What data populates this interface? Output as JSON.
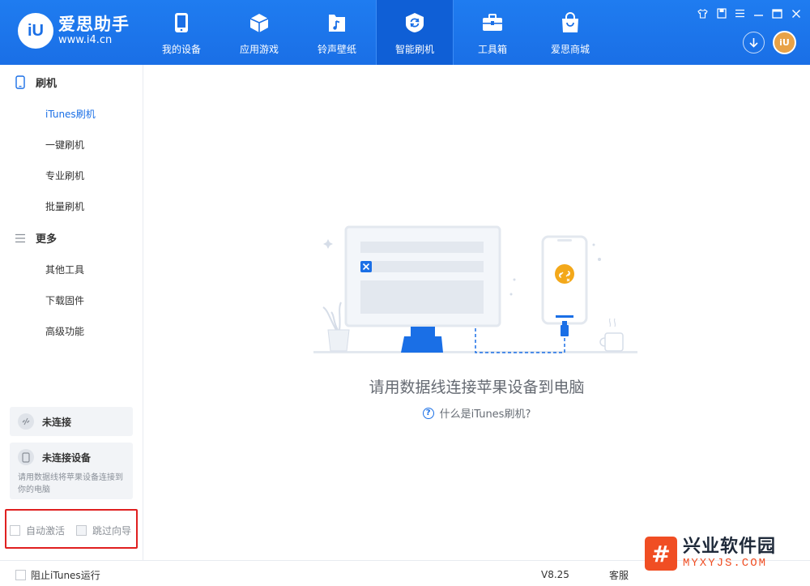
{
  "app": {
    "name": "爱思助手",
    "url": "www.i4.cn",
    "logo_mark": "iU",
    "brand_color": "#1a6fe6"
  },
  "nav": {
    "items": [
      {
        "label": "我的设备",
        "icon": "phone-icon"
      },
      {
        "label": "应用游戏",
        "icon": "cube-icon"
      },
      {
        "label": "铃声壁纸",
        "icon": "music-file-icon"
      },
      {
        "label": "智能刷机",
        "icon": "refresh-shield-icon",
        "active": true
      },
      {
        "label": "工具箱",
        "icon": "toolbox-icon"
      },
      {
        "label": "爱思商城",
        "icon": "shopping-bag-icon"
      }
    ]
  },
  "window_controls": [
    "shirt-icon",
    "clipboard-icon",
    "menu-icon",
    "minimize-icon",
    "maximize-icon",
    "close-icon"
  ],
  "header_right": {
    "download_icon": "download-icon",
    "avatar_text": "iU"
  },
  "sidebar": {
    "group_flash": {
      "label": "刷机",
      "icon": "phone-outline-icon"
    },
    "flash_items": [
      {
        "label": "iTunes刷机",
        "active": true
      },
      {
        "label": "一键刷机"
      },
      {
        "label": "专业刷机"
      },
      {
        "label": "批量刷机"
      }
    ],
    "group_more": {
      "label": "更多",
      "icon": "list-icon"
    },
    "more_items": [
      {
        "label": "其他工具"
      },
      {
        "label": "下载固件"
      },
      {
        "label": "高级功能"
      }
    ],
    "status_connection": {
      "title": "未连接",
      "icon": "unlink-icon"
    },
    "status_device": {
      "title": "未连接设备",
      "desc": "请用数据线将苹果设备连接到你的电脑",
      "icon": "device-icon"
    },
    "options": {
      "auto_activate": "自动激活",
      "skip_guide": "跳过向导"
    }
  },
  "main": {
    "message": "请用数据线连接苹果设备到电脑",
    "help_link": "什么是iTunes刷机?"
  },
  "statusbar": {
    "block_itunes": "阻止iTunes运行",
    "version": "V8.25",
    "service": "客服"
  },
  "watermark": {
    "badge": "#",
    "title": "兴业软件园",
    "subtitle": "MYXYJS.COM"
  }
}
